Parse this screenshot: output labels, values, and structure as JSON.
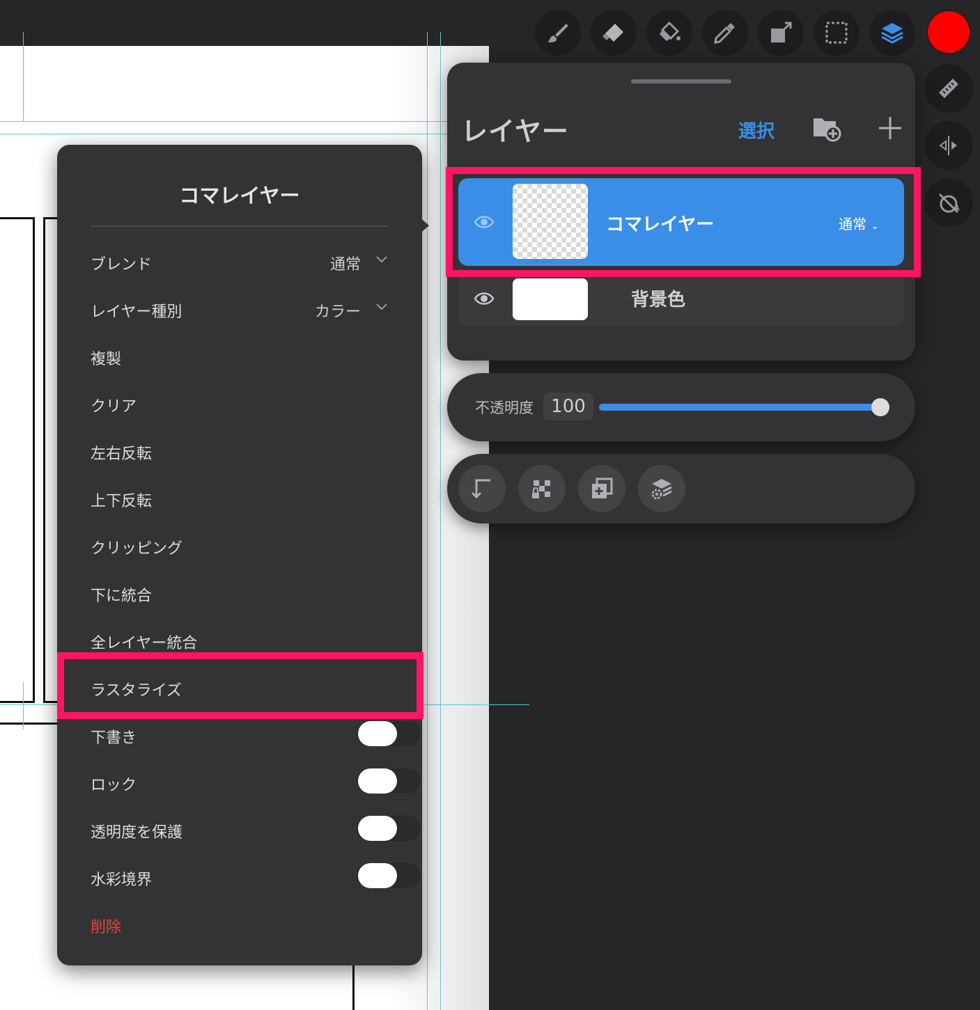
{
  "toolbar": {
    "tools": [
      "brush-icon",
      "eraser-icon",
      "paint-bucket-icon",
      "eyedropper-icon",
      "transform-icon",
      "selection-icon",
      "layers-icon"
    ],
    "active_color": "#ff0000",
    "side_tools": [
      "ruler-icon",
      "symmetry-icon",
      "rotate-lock-icon"
    ]
  },
  "layer_panel": {
    "title": "レイヤー",
    "select_label": "選択",
    "layers": [
      {
        "name": "コマレイヤー",
        "blend": "通常",
        "selected": true
      },
      {
        "name": "背景色",
        "selected": false
      }
    ]
  },
  "opacity": {
    "label": "不透明度",
    "value": "100",
    "fraction": 1.0
  },
  "actions": [
    "merge-down-icon",
    "checker-lock-icon",
    "duplicate-icon",
    "layer-settings-icon"
  ],
  "context_menu": {
    "title": "コマレイヤー",
    "blend": {
      "label": "ブレンド",
      "value": "通常"
    },
    "layer_type": {
      "label": "レイヤー種別",
      "value": "カラー"
    },
    "items": [
      "複製",
      "クリア",
      "左右反転",
      "上下反転",
      "クリッピング",
      "下に統合",
      "全レイヤー統合",
      "ラスタライズ"
    ],
    "toggles": [
      {
        "label": "下書き",
        "on": false
      },
      {
        "label": "ロック",
        "on": false
      },
      {
        "label": "透明度を保護",
        "on": false
      },
      {
        "label": "水彩境界",
        "on": false
      }
    ],
    "delete_label": "削除"
  },
  "colors": {
    "accent": "#3a8ee8",
    "highlight": "#ff1466",
    "danger": "#e8443c"
  }
}
